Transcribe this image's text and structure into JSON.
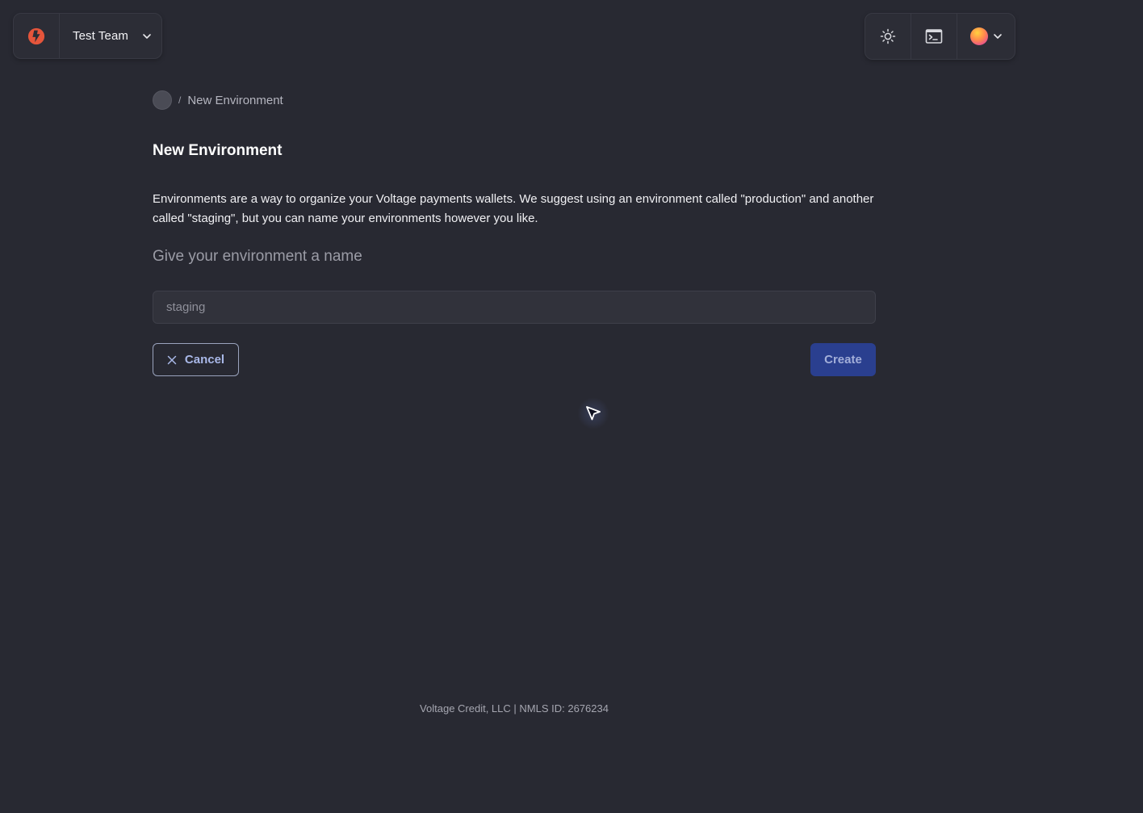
{
  "header": {
    "team_name": "Test Team",
    "team_logo_icon": "voltage-logo-icon",
    "brand_color": "#e5553b",
    "toolbar": {
      "theme_toggle_icon": "sun-icon",
      "console_icon": "terminal-icon",
      "user_menu_icon": "avatar"
    }
  },
  "breadcrumb": {
    "separator": "/",
    "current": "New Environment"
  },
  "page": {
    "title": "New Environment",
    "description": "Environments are a way to organize your Voltage payments wallets. We suggest using an environment called \"production\" and another called \"staging\", but you can name your environments however you like.",
    "field_label": "Give your environment a name",
    "input": {
      "value": "",
      "placeholder": "staging"
    },
    "cancel_label": "Cancel",
    "create_label": "Create",
    "primary_color": "#2a3f8f"
  },
  "footer": {
    "text": "Voltage Credit, LLC | NMLS ID: 2676234"
  }
}
